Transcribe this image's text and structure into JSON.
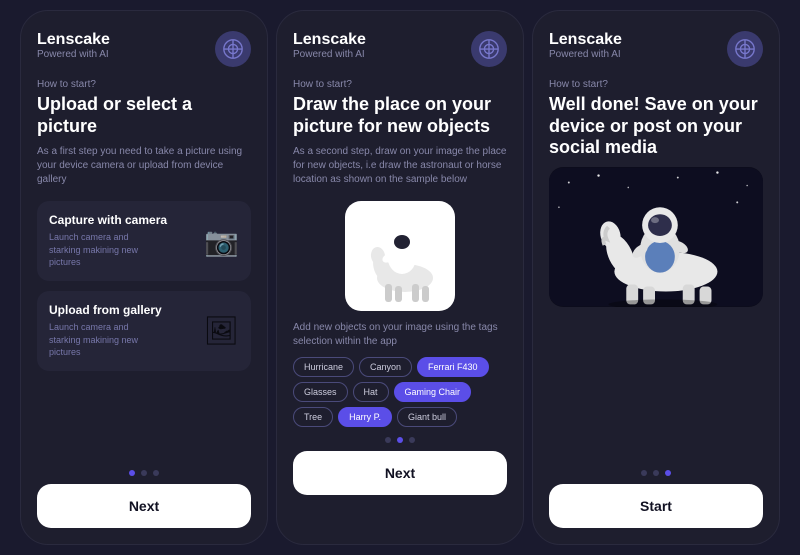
{
  "screens": [
    {
      "id": "screen1",
      "logo": "Lenscake",
      "powered": "Powered with AI",
      "how_to_start": "How to start?",
      "title": "Upload or select a picture",
      "description": "As a first step you need to take a picture using your device camera or upload from device gallery",
      "options": [
        {
          "title": "Capture with camera",
          "desc": "Launch camera and starking makining new pictures",
          "icon": "📷"
        },
        {
          "title": "Upload from gallery",
          "desc": "Launch camera and starking makining new pictures",
          "icon": "🖼"
        }
      ],
      "dots": [
        true,
        false,
        false
      ],
      "button": "Next"
    },
    {
      "id": "screen2",
      "logo": "Lenscake",
      "powered": "Powered with AI",
      "how_to_start": "How to start?",
      "title": "Draw the place on your picture for new objects",
      "description": "As a second step, draw on your image the place for new objects, i.e draw the astronaut or horse location as shown on the sample below",
      "tags_desc": "Add new objects on your image using the tags selection within the app",
      "tags": [
        {
          "label": "Hurricane",
          "highlighted": false
        },
        {
          "label": "Canyon",
          "highlighted": false
        },
        {
          "label": "Ferrari F430",
          "highlighted": true
        },
        {
          "label": "Glasses",
          "highlighted": false
        },
        {
          "label": "Hat",
          "highlighted": false
        },
        {
          "label": "Gaming Chair",
          "highlighted": true
        },
        {
          "label": "Tree",
          "highlighted": false
        },
        {
          "label": "Harry P.",
          "highlighted": true
        },
        {
          "label": "Giant bull",
          "highlighted": false
        }
      ],
      "dots": [
        false,
        true,
        false
      ],
      "button": "Next"
    },
    {
      "id": "screen3",
      "logo": "Lenscake",
      "powered": "Powered with AI",
      "how_to_start": "How to start?",
      "title": "Well done! Save on your device or post on your social media",
      "dots": [
        false,
        false,
        true
      ],
      "button": "Start"
    }
  ]
}
